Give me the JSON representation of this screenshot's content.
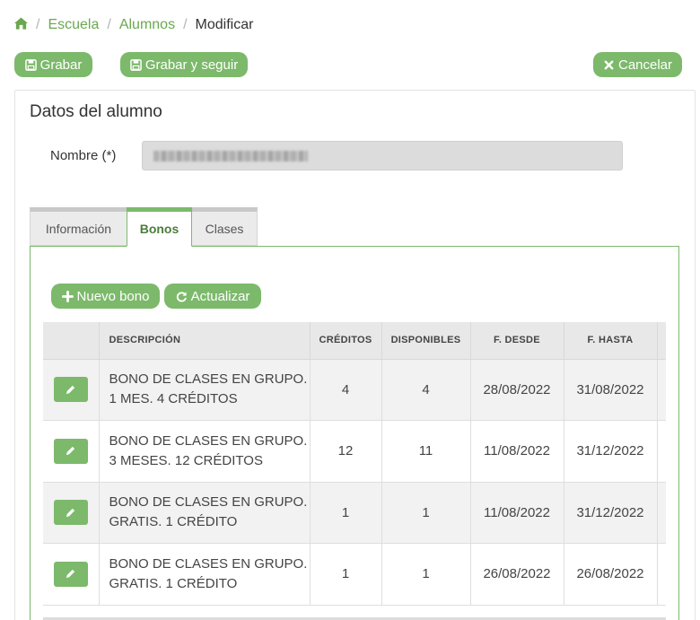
{
  "breadcrumb": {
    "items": [
      "Escuela",
      "Alumnos"
    ],
    "current": "Modificar"
  },
  "toolbar": {
    "save_label": "Grabar",
    "save_continue_label": "Grabar y seguir",
    "cancel_label": "Cancelar"
  },
  "panel": {
    "title": "Datos del alumno",
    "name_label": "Nombre (*)",
    "name_value": ""
  },
  "tabs": [
    {
      "label": "Información",
      "active": false
    },
    {
      "label": "Bonos",
      "active": true
    },
    {
      "label": "Clases",
      "active": false
    }
  ],
  "bonos": {
    "new_label": "Nuevo bono",
    "refresh_label": "Actualizar",
    "columns": [
      "",
      "DESCRIPCIÓN",
      "CRÉDITOS",
      "DISPONIBLES",
      "F. DESDE",
      "F. HASTA"
    ],
    "rows": [
      {
        "desc1": "BONO DE CLASES EN GRUPO.",
        "desc2": "1 MES. 4 CRÉDITOS",
        "creditos": "4",
        "disponibles": "4",
        "desde": "28/08/2022",
        "hasta": "31/08/2022"
      },
      {
        "desc1": "BONO DE CLASES EN GRUPO.",
        "desc2": "3 MESES. 12 CRÉDITOS",
        "creditos": "12",
        "disponibles": "11",
        "desde": "11/08/2022",
        "hasta": "31/12/2022"
      },
      {
        "desc1": "BONO DE CLASES EN GRUPO.",
        "desc2": "GRATIS. 1 CRÉDITO",
        "creditos": "1",
        "disponibles": "1",
        "desde": "11/08/2022",
        "hasta": "31/12/2022"
      },
      {
        "desc1": "BONO DE CLASES EN GRUPO.",
        "desc2": "GRATIS. 1 CRÉDITO",
        "creditos": "1",
        "disponibles": "1",
        "desde": "26/08/2022",
        "hasta": "26/08/2022"
      }
    ]
  },
  "icons": {
    "home": "home-icon",
    "save": "floppy-disk-icon",
    "cancel": "times-icon",
    "add": "plus-icon",
    "refresh": "refresh-icon",
    "edit": "pencil-icon"
  },
  "colors": {
    "accent": "#7cb96b",
    "link": "#6aa84f"
  }
}
